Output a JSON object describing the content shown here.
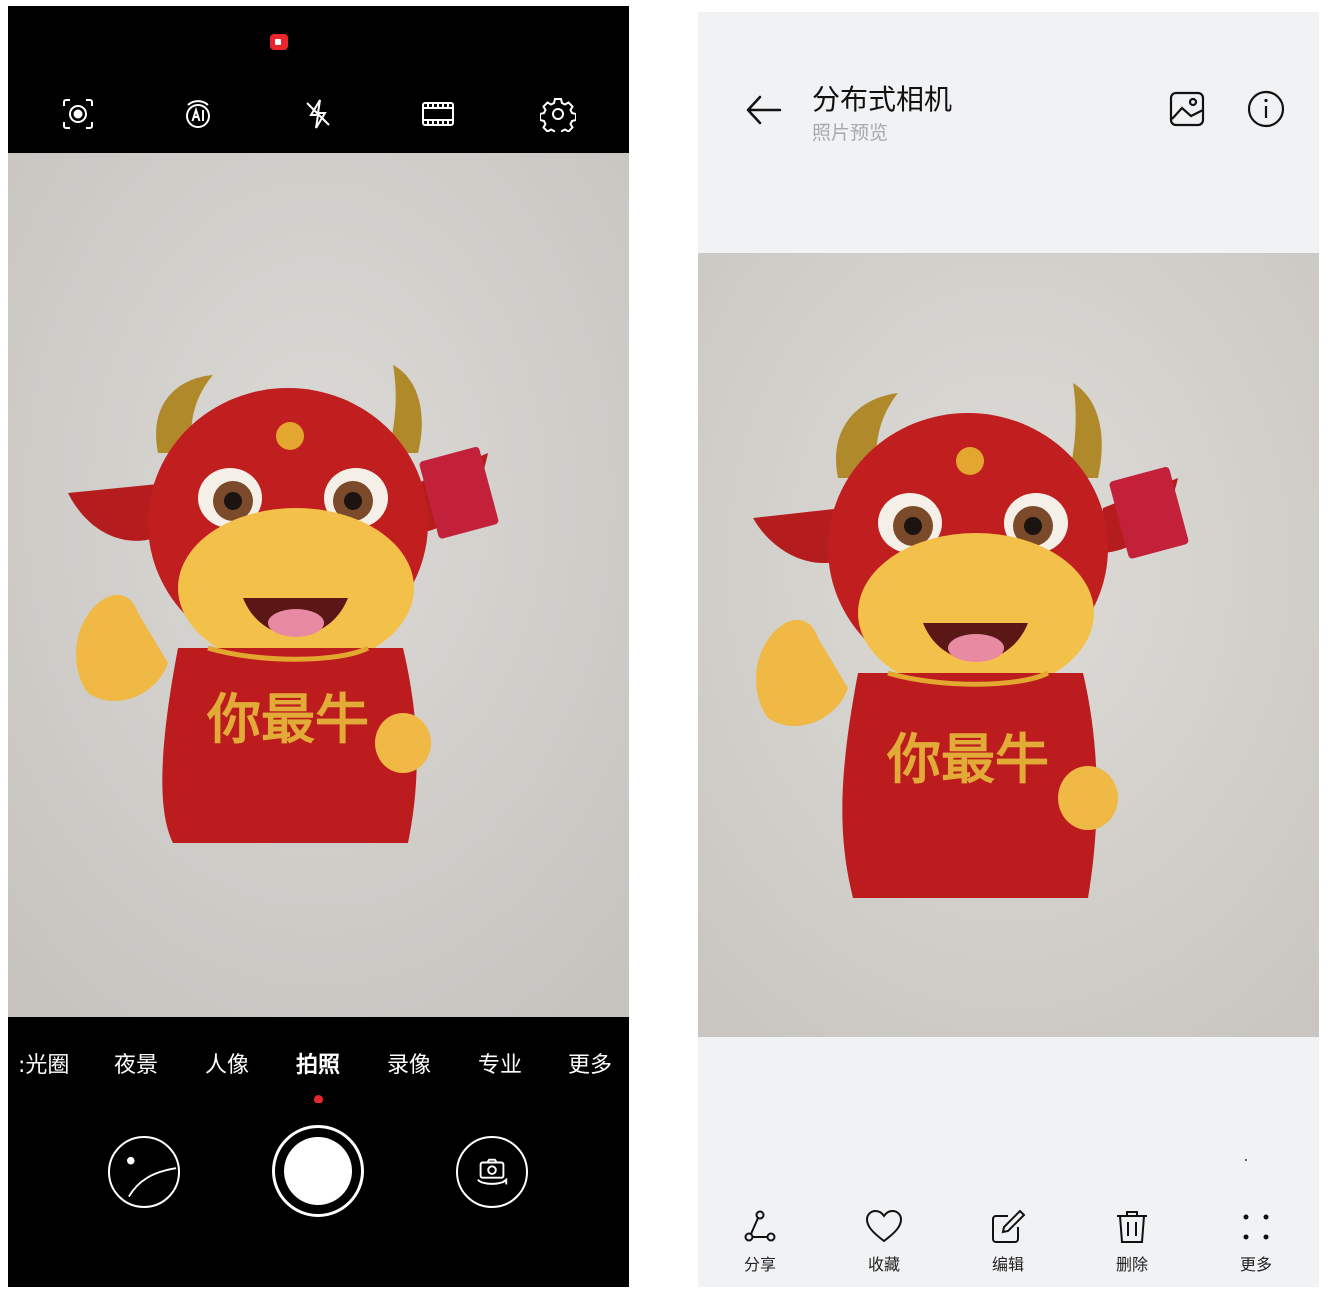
{
  "camera": {
    "recording_indicator": "record-indicator",
    "toolbar": [
      {
        "icon": "smart-lens-icon"
      },
      {
        "icon": "ai-icon"
      },
      {
        "icon": "flash-off-icon"
      },
      {
        "icon": "film-frame-icon"
      },
      {
        "icon": "settings-gear-icon"
      }
    ],
    "viewfinder_subject": {
      "shirt_text": "你最牛"
    },
    "modes": [
      ":光圈",
      "夜景",
      "人像",
      "拍照",
      "录像",
      "专业",
      "更多"
    ],
    "active_mode": "拍照",
    "accent_color": "#e8262c"
  },
  "preview": {
    "title": "分布式相机",
    "subtitle": "照片预览",
    "photo_subject": {
      "shirt_text": "你最牛"
    },
    "actions": [
      {
        "label": "分享",
        "icon": "share-icon"
      },
      {
        "label": "收藏",
        "icon": "heart-icon"
      },
      {
        "label": "编辑",
        "icon": "edit-icon"
      },
      {
        "label": "删除",
        "icon": "trash-icon"
      },
      {
        "label": "更多",
        "icon": "more-dots-icon"
      }
    ]
  }
}
